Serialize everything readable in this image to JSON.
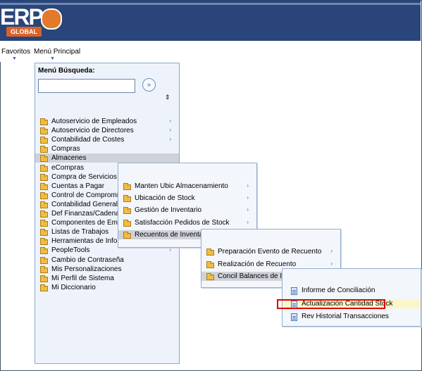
{
  "header": {
    "logo_main": "ERP",
    "logo_sub": "GLOBAL"
  },
  "nav": {
    "favoritos": "Favoritos",
    "menu_principal": "Menú Principal"
  },
  "search": {
    "label": "Menú Búsqueda:",
    "value": "",
    "go": "»",
    "sort": "⇕"
  },
  "main_menu": [
    {
      "label": "Autoservicio de Empleados",
      "arrow": "›"
    },
    {
      "label": "Autoservicio de Directores",
      "arrow": "›"
    },
    {
      "label": "Contabilidad de Costes",
      "arrow": "›"
    },
    {
      "label": "Compras",
      "arrow": ""
    },
    {
      "label": "Almacenes",
      "arrow": ""
    },
    {
      "label": "eCompras",
      "arrow": "›"
    },
    {
      "label": "Compra de Servicios",
      "arrow": "›"
    },
    {
      "label": "Cuentas a Pagar",
      "arrow": "›"
    },
    {
      "label": "Control de Compromisos",
      "arrow": ""
    },
    {
      "label": "Contabilidad General",
      "arrow": ""
    },
    {
      "label": "Def Finanzas/Cadena Suministro",
      "arrow": ""
    },
    {
      "label": "Componentes de Empresa",
      "arrow": "›"
    },
    {
      "label": "Listas de Trabajos",
      "arrow": "›"
    },
    {
      "label": "Herramientas de Informes",
      "arrow": "›"
    },
    {
      "label": "PeopleTools",
      "arrow": "›"
    },
    {
      "label": "Cambio de Contraseña",
      "arrow": ""
    },
    {
      "label": "Mis Personalizaciones",
      "arrow": ""
    },
    {
      "label": "Mi Perfil de Sistema",
      "arrow": ""
    },
    {
      "label": "Mi Diccionario",
      "arrow": ""
    }
  ],
  "submenu_almacenes": [
    {
      "label": "Manten Ubic Almacenamiento",
      "arrow": "›"
    },
    {
      "label": "Ubicación de Stock",
      "arrow": "›"
    },
    {
      "label": "Gestión de Inventario",
      "arrow": "›"
    },
    {
      "label": "Satisfacción Pedidos de Stock",
      "arrow": "›"
    },
    {
      "label": "Recuentos de Inventario",
      "arrow": ""
    }
  ],
  "submenu_recuentos": [
    {
      "label": "Preparación Evento de Recuento",
      "arrow": "›"
    },
    {
      "label": "Realización de Recuento",
      "arrow": "›"
    },
    {
      "label": "Concil Balances de Inventario",
      "arrow": ""
    }
  ],
  "submenu_concil": [
    {
      "label": "Informe de Conciliación"
    },
    {
      "label": "Actualización Cantidad Stock"
    },
    {
      "label": "Rev Historial Transacciones"
    }
  ],
  "colors": {
    "header": "#29457a",
    "panel": "#eef3fb",
    "highlight": "#e00000"
  }
}
